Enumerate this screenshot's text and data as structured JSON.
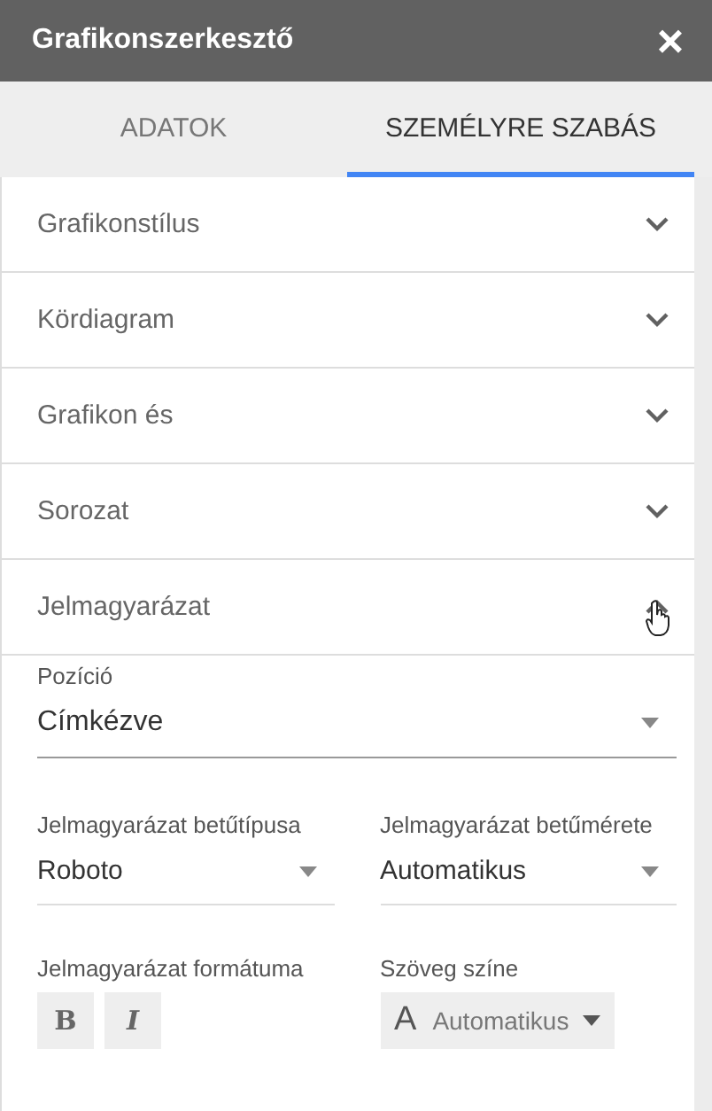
{
  "window": {
    "title": "Grafikonszerkesztő",
    "close": "×"
  },
  "tabs": [
    {
      "label": "ADATOK",
      "selected": false
    },
    {
      "label": "SZEMÉLYRE SZABÁS",
      "selected": true
    }
  ],
  "sections": [
    {
      "title": "Grafikonstílus",
      "expanded": false
    },
    {
      "title": "Kördiagram",
      "expanded": false
    },
    {
      "title": "Grafikon és",
      "expanded": false
    },
    {
      "title": "Sorozat",
      "expanded": false
    },
    {
      "title": "Jelmagyarázat",
      "expanded": true
    }
  ],
  "legend": {
    "position": {
      "label": "Pozíció",
      "value": "Címkézve"
    },
    "font": {
      "label": "Jelmagyarázat betűtípusa",
      "value": "Roboto"
    },
    "size": {
      "label": "Jelmagyarázat betűmérete",
      "value": "Automatikus"
    },
    "format": {
      "label": "Jelmagyarázat formátuma",
      "bold": {
        "label": "B",
        "on": false
      },
      "italic": {
        "label": "I",
        "on": false
      }
    },
    "text_color": {
      "label": "Szöveg színe",
      "glyph": "A",
      "value": "Automatikus"
    }
  }
}
